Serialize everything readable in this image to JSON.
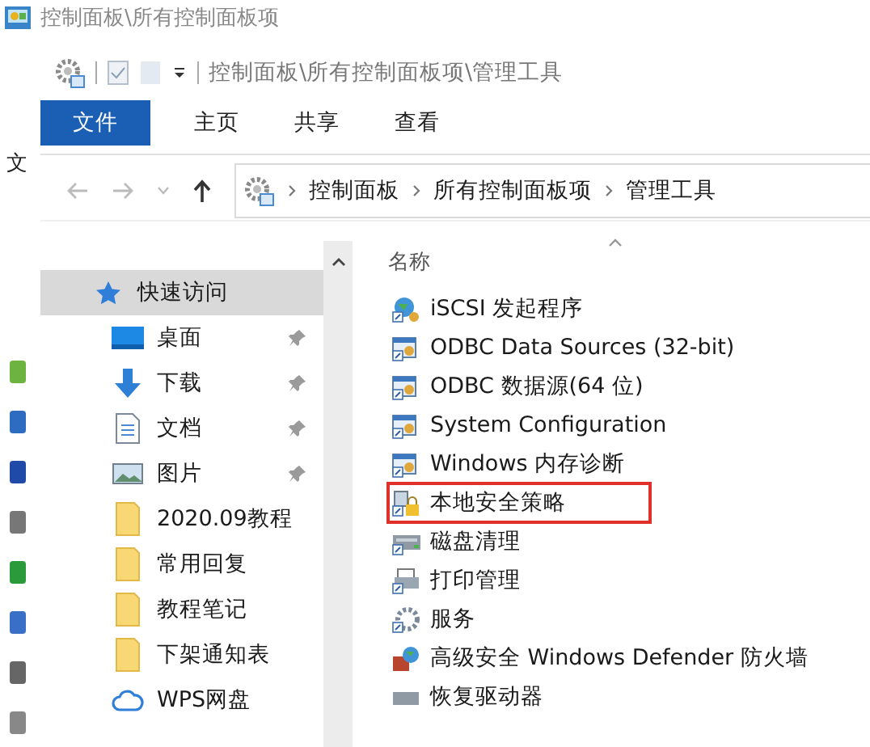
{
  "background_window": {
    "title": "控制面板\\所有控制面板项",
    "menu_label": "文"
  },
  "explorer": {
    "title": "控制面板\\所有控制面板项\\管理工具",
    "ribbon_tabs": [
      {
        "label": "文件",
        "selected": true
      },
      {
        "label": "主页",
        "selected": false
      },
      {
        "label": "共享",
        "selected": false
      },
      {
        "label": "查看",
        "selected": false
      }
    ],
    "address": {
      "segments": [
        "控制面板",
        "所有控制面板项",
        "管理工具"
      ]
    },
    "nav_items": [
      {
        "label": "快速访问",
        "kind": "star",
        "pinned": false,
        "selected": true
      },
      {
        "label": "桌面",
        "kind": "desktop",
        "pinned": true,
        "selected": false
      },
      {
        "label": "下载",
        "kind": "download",
        "pinned": true,
        "selected": false
      },
      {
        "label": "文档",
        "kind": "document",
        "pinned": true,
        "selected": false
      },
      {
        "label": "图片",
        "kind": "pictures",
        "pinned": true,
        "selected": false
      },
      {
        "label": "2020.09教程",
        "kind": "folder",
        "pinned": false,
        "selected": false
      },
      {
        "label": "常用回复",
        "kind": "folder",
        "pinned": false,
        "selected": false
      },
      {
        "label": "教程笔记",
        "kind": "folder",
        "pinned": false,
        "selected": false
      },
      {
        "label": "下架通知表",
        "kind": "folder",
        "pinned": false,
        "selected": false
      },
      {
        "label": "WPS网盘",
        "kind": "cloud",
        "pinned": false,
        "selected": false
      }
    ],
    "list": {
      "column": "名称",
      "items": [
        {
          "label": "iSCSI 发起程序",
          "kind": "globe",
          "highlighted": false
        },
        {
          "label": "ODBC Data Sources (32-bit)",
          "kind": "tool",
          "highlighted": false
        },
        {
          "label": "ODBC 数据源(64 位)",
          "kind": "tool",
          "highlighted": false
        },
        {
          "label": "System Configuration",
          "kind": "tool",
          "highlighted": false
        },
        {
          "label": "Windows 内存诊断",
          "kind": "tool",
          "highlighted": false
        },
        {
          "label": "本地安全策略",
          "kind": "lock",
          "highlighted": true
        },
        {
          "label": "磁盘清理",
          "kind": "disk",
          "highlighted": false
        },
        {
          "label": "打印管理",
          "kind": "printer",
          "highlighted": false
        },
        {
          "label": "服务",
          "kind": "gear",
          "highlighted": false
        },
        {
          "label": "高级安全 Windows Defender 防火墙",
          "kind": "firewall",
          "highlighted": false
        },
        {
          "label": "恢复驱动器",
          "kind": "drive",
          "highlighted": false
        }
      ]
    }
  }
}
